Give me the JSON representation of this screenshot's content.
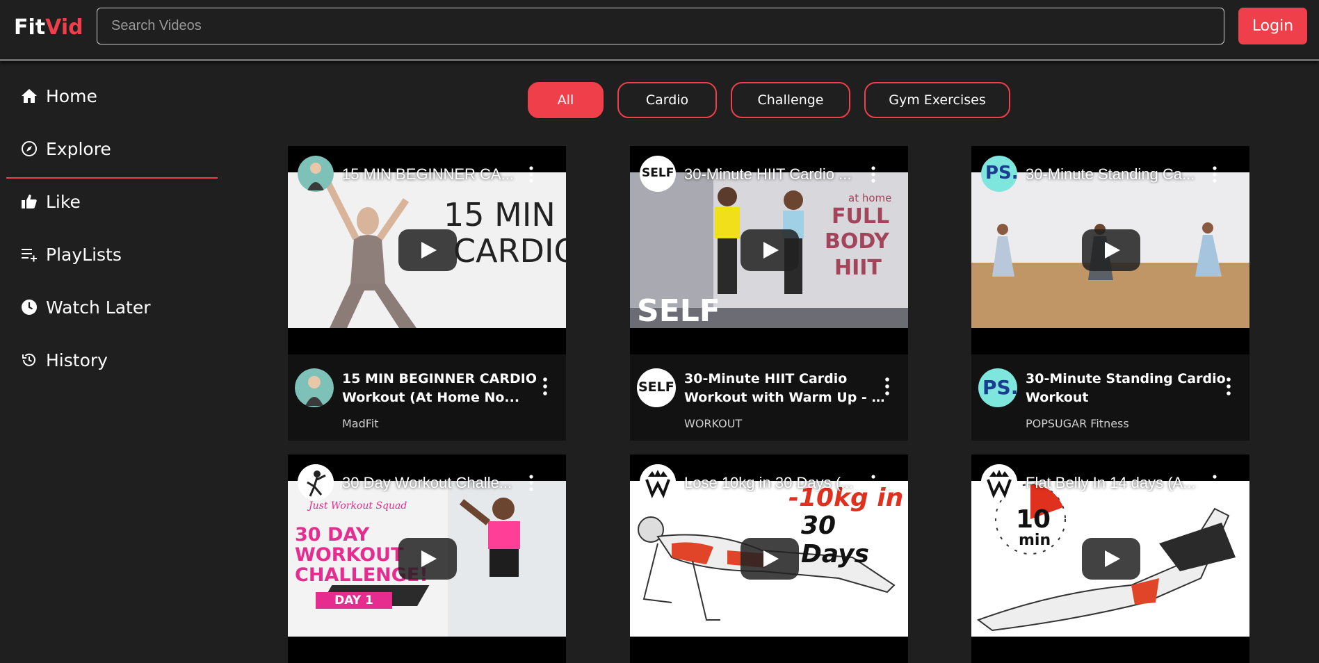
{
  "app": {
    "logo_part1": "Fit",
    "logo_part2": "Vid",
    "brand_color": "#ef3f4a",
    "search_placeholder": "Search Videos",
    "login_label": "Login"
  },
  "sidebar": {
    "items": [
      {
        "label": "Home",
        "icon": "home-icon"
      },
      {
        "label": "Explore",
        "icon": "compass-icon",
        "active": true
      },
      {
        "label": "Like",
        "icon": "thumbs-up-icon"
      },
      {
        "label": "PlayLists",
        "icon": "playlist-add-icon"
      },
      {
        "label": "Watch Later",
        "icon": "clock-icon"
      },
      {
        "label": "History",
        "icon": "history-icon"
      }
    ]
  },
  "filters": {
    "chips": [
      "All",
      "Cardio",
      "Challenge",
      "Gym Exercises"
    ],
    "selected": "All"
  },
  "videos": [
    {
      "overlay_title": "15 MIN BEGINNER CA...",
      "title_line1": "15 MIN BEGINNER CARDIO",
      "title_line2": "Workout (At Home No...",
      "channel": "MadFit",
      "thumb_text1": "15 MIN",
      "thumb_text2": "CARDIO"
    },
    {
      "overlay_title": "30-Minute HIIT Cardio ...",
      "title_line1": "30-Minute HIIT Cardio",
      "title_line2": "Workout with Warm Up - No...",
      "channel": "WORKOUT",
      "avatar_text": "SELF",
      "thumb_text1": "at home",
      "thumb_text2": "FULL",
      "thumb_text3": "BODY",
      "thumb_text4": "HIIT",
      "thumb_text5": "SELF"
    },
    {
      "overlay_title": "30-Minute Standing Ca...",
      "title_line1": "30-Minute Standing Cardio",
      "title_line2": "Workout",
      "channel": "POPSUGAR Fitness",
      "avatar_text": "PS."
    },
    {
      "overlay_title": "30 Day Workout Challe...",
      "thumb_text1": "Just Workout Squad",
      "thumb_text2": "30 DAY",
      "thumb_text3": "WORKOUT",
      "thumb_text4": "CHALLENGE!",
      "thumb_text5": "DAY 1"
    },
    {
      "overlay_title": "Lose 10kg in 30 Days (...",
      "thumb_text1": "-10kg in",
      "thumb_text2": "30 Days"
    },
    {
      "overlay_title": "Flat Belly In 14 days (A...",
      "thumb_text1": "10",
      "thumb_text2": "min"
    }
  ]
}
